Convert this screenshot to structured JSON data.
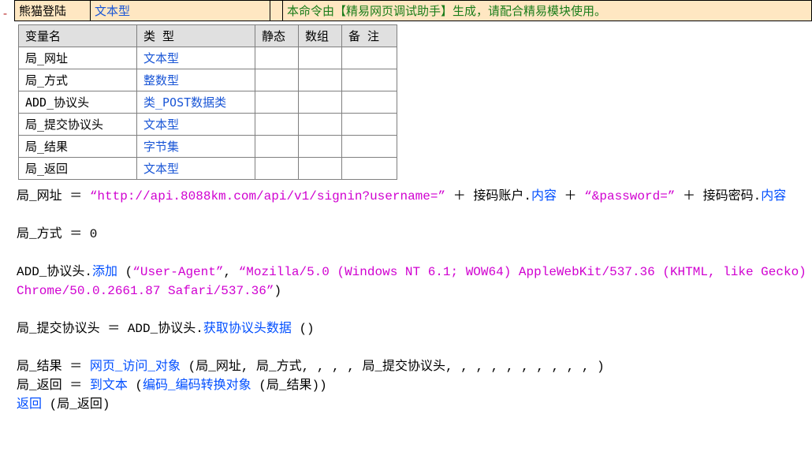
{
  "header": {
    "name": "熊猫登陆",
    "type": "文本型",
    "comment": "本命令由【精易网页调试助手】生成，请配合精易模块使用。"
  },
  "vars_table": {
    "headers": [
      "变量名",
      "类 型",
      "静态",
      "数组",
      "备 注"
    ],
    "rows": [
      {
        "name": "局_网址",
        "type": "文本型"
      },
      {
        "name": "局_方式",
        "type": "整数型"
      },
      {
        "name": "ADD_协议头",
        "type": "类_POST数据类"
      },
      {
        "name": "局_提交协议头",
        "type": "文本型"
      },
      {
        "name": "局_结果",
        "type": "字节集"
      },
      {
        "name": "局_返回",
        "type": "文本型"
      }
    ]
  },
  "code": {
    "l1_a": "局_网址 ＝ ",
    "l1_str1": "“http://api.8088km.com/api/v1/signin?username=”",
    "l1_plus": " ＋ ",
    "l1_obj1": "接码账户",
    "l1_dot": ".",
    "l1_mem": "内容",
    "l1_str2": "“&password=”",
    "l1_obj2": "接码密码",
    "l2": "局_方式 ＝ 0",
    "l3_a": "ADD_协议头.",
    "l3_fn": "添加",
    "l3_args": " (“User-Agent”,  “Mozilla/5.0 (Windows NT 6.1; WOW64) AppleWebKit/537.36 (KHTML, like Gecko) Chrome/50.0.2661.87 Safari/537.36”)",
    "l3_str1": "“User-Agent”",
    "l3_str2": "“Mozilla/5.0 (Windows NT 6.1; WOW64) AppleWebKit/537.36 (KHTML, like Gecko) Chrome/50.0.2661.87 Safari/537.36”",
    "l4_a": "局_提交协议头 ＝ ADD_协议头.",
    "l4_fn": "获取协议头数据",
    "l4_p": " ()",
    "l5_a": "局_结果 ＝ ",
    "l5_fn": "网页_访问_对象",
    "l5_args": " (局_网址, 局_方式, , , , 局_提交协议头, , , , , , , , , , )",
    "l6_a": "局_返回 ＝ ",
    "l6_fn": "到文本",
    "l6_inner_fn": "编码_编码转换对象",
    "l6_args_outer_open": " (",
    "l6_args_inner": " (局_结果)",
    "l6_args_outer_close": ")",
    "l7_kw": "返回",
    "l7_args": " (局_返回)"
  }
}
